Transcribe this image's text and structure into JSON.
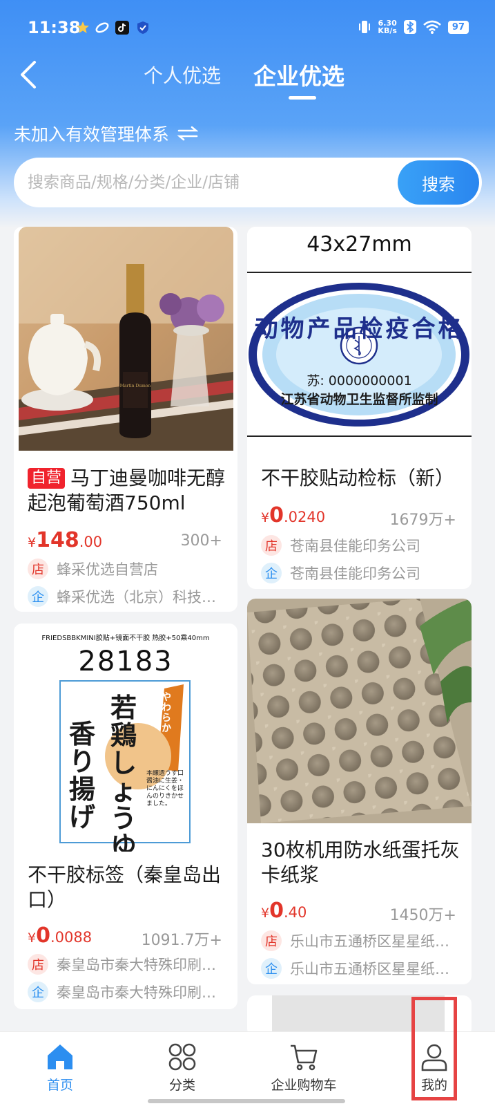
{
  "status_bar": {
    "time": "11:38",
    "net_speed_value": "6.30",
    "net_speed_unit": "KB/s",
    "battery": "97"
  },
  "header": {
    "tabs": [
      {
        "label": "个人优选",
        "active": false
      },
      {
        "label": "企业优选",
        "active": true
      }
    ],
    "management_text": "未加入有效管理体系",
    "search": {
      "placeholder": "搜索商品/规格/分类/企业/店铺",
      "button": "搜索"
    }
  },
  "products": [
    {
      "self_run_tag": "自营",
      "title": "马丁迪曼咖啡无醇起泡葡萄酒750ml",
      "price_currency": "¥",
      "price_int": "148",
      "price_dec": ".00",
      "sold": "300+",
      "store": "蜂采优选自营店",
      "enterprise": "蜂采优选（北京）科技有限公司",
      "image": {
        "type": "photo",
        "description_icon": "wine-bottle-image",
        "bottle_label": "Martin Dumon"
      }
    },
    {
      "title": "不干胶贴动检标（新）",
      "price_currency": "¥",
      "price_int": "0",
      "price_dec": ".0240",
      "sold": "1679万+",
      "store": "苍南县佳能印务公司",
      "enterprise": "苍南县佳能印务公司",
      "image": {
        "size_text": "43x27mm",
        "seal_title": "动物产品检疫合格",
        "seal_number": "苏: 0000000001",
        "seal_issuer": "江苏省动物卫生监督所监制"
      }
    },
    {
      "title": "不干胶标签（秦皇岛出口）",
      "price_currency": "¥",
      "price_int": "0",
      "price_dec": ".0088",
      "sold": "1091.7万+",
      "store": "秦皇岛市秦大特殊印刷有限公司",
      "enterprise": "秦皇岛市秦大特殊印刷有限公司",
      "image": {
        "top_text": "FRIEDSBBKMINI胶贴+镜面不干胶 热胶+50乘40mm",
        "code": "28183",
        "label_small": "やわらか",
        "label_big_1": "若鶏しょうゆ",
        "label_big_2": "香り揚げ",
        "label_side": "本醸造うす口醤油に生姜・にんにくをほんのりきかせました。"
      }
    },
    {
      "title": "30枚机用防水纸蛋托灰卡纸浆",
      "price_currency": "¥",
      "price_int": "0",
      "price_dec": ".40",
      "sold": "1450万+",
      "store": "乐山市五通桥区星星纸制品厂",
      "enterprise": "乐山市五通桥区星星纸制品厂",
      "image": {
        "type": "photo",
        "description_icon": "egg-tray-image"
      }
    }
  ],
  "bottom_nav": [
    {
      "label": "首页",
      "icon": "home-icon",
      "active": true
    },
    {
      "label": "分类",
      "icon": "category-icon",
      "active": false
    },
    {
      "label": "企业购物车",
      "icon": "cart-icon",
      "active": false
    },
    {
      "label": "我的",
      "icon": "user-icon",
      "active": false
    }
  ],
  "colors": {
    "brand_blue": "#3f8ff5",
    "price_red": "#e2352a",
    "highlight": "#e64343"
  }
}
